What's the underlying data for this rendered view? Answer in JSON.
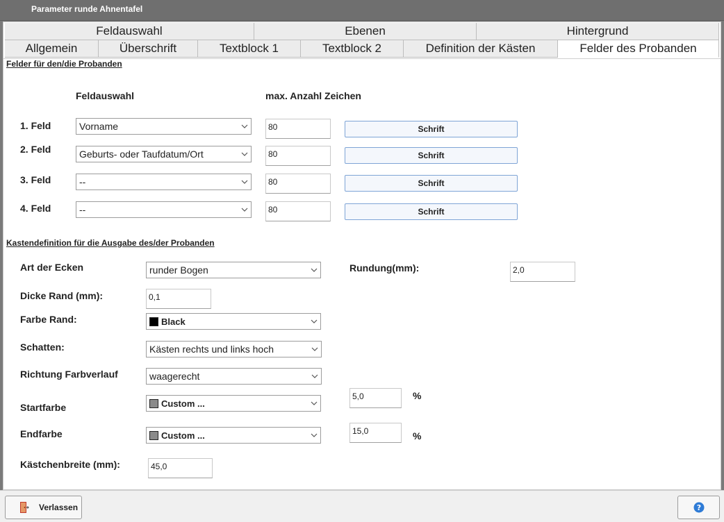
{
  "window": {
    "title": "Parameter runde Ahnentafel"
  },
  "tabs_row1": [
    {
      "label": "Feldauswahl"
    },
    {
      "label": "Ebenen"
    },
    {
      "label": "Hintergrund"
    }
  ],
  "tabs_row2": [
    {
      "label": "Allgemein"
    },
    {
      "label": "Überschrift"
    },
    {
      "label": "Textblock 1"
    },
    {
      "label": "Textblock 2"
    },
    {
      "label": "Definition der Kästen"
    },
    {
      "label": "Felder des Probanden"
    }
  ],
  "fields_section": {
    "title": "Felder für den/die Probanden",
    "col_feldauswahl": "Feldauswahl",
    "col_max_chars": "max. Anzahl Zeichen",
    "rows": [
      {
        "label": "1. Feld",
        "select": "Vorname",
        "max": "80",
        "button": "Schrift"
      },
      {
        "label": "2. Feld",
        "select": "Geburts- oder Taufdatum/Ort",
        "max": "80",
        "button": "Schrift"
      },
      {
        "label": "3. Feld",
        "select": "--",
        "max": "80",
        "button": "Schrift"
      },
      {
        "label": "4. Feld",
        "select": "--",
        "max": "80",
        "button": "Schrift"
      }
    ]
  },
  "box_section": {
    "title": "Kastendefinition für die Ausgabe des/der Probanden",
    "corners_label": "Art der Ecken",
    "corners_value": "runder Bogen",
    "rounding_label": "Rundung(mm):",
    "rounding_value": "2,0",
    "border_thickness_label": "Dicke Rand (mm):",
    "border_thickness_value": "0,1",
    "border_color_label": "Farbe Rand:",
    "border_color_value": "Black",
    "border_color_swatch": "#000000",
    "shadow_label": "Schatten:",
    "shadow_value": "Kästen rechts und links hoch",
    "gradient_dir_label": "Richtung Farbverlauf",
    "gradient_dir_value": "waagerecht",
    "start_color_label": "Startfarbe",
    "start_color_value": "Custom ...",
    "start_color_swatch": "#8a8a8a",
    "start_percent_value": "5,0",
    "start_percent_unit": "%",
    "end_color_label": "Endfarbe",
    "end_color_value": "Custom ...",
    "end_color_swatch": "#8a8a8a",
    "end_percent_value": "15,0",
    "end_percent_unit": "%",
    "box_width_label": "Kästchenbreite (mm):",
    "box_width_value": "45,0"
  },
  "footer": {
    "exit_label": "Verlassen"
  }
}
